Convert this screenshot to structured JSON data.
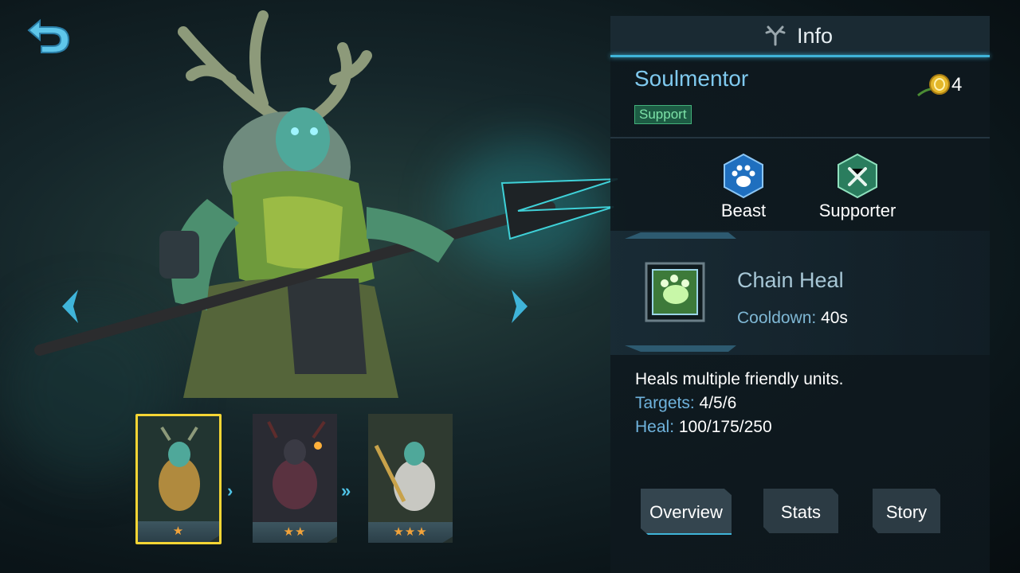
{
  "header": {
    "title": "Info"
  },
  "hero": {
    "name": "Soulmentor",
    "role": "Support",
    "cost": "4"
  },
  "traits": [
    {
      "label": "Beast",
      "icon": "paw-icon",
      "color": "#1f6fbf"
    },
    {
      "label": "Supporter",
      "icon": "hammer-icon",
      "color": "#2a7d5e"
    }
  ],
  "ability": {
    "name": "Chain Heal",
    "cooldown_label": "Cooldown:",
    "cooldown_value": "40s",
    "description": "Heals multiple friendly units.",
    "stats": [
      {
        "label": "Targets:",
        "value": "4/5/6"
      },
      {
        "label": "Heal:",
        "value": "100/175/250"
      }
    ]
  },
  "skins": [
    {
      "stars": "★",
      "selected": true
    },
    {
      "stars": "★★",
      "selected": false
    },
    {
      "stars": "★★★",
      "selected": false
    }
  ],
  "tabs": [
    {
      "label": "Overview",
      "active": true
    },
    {
      "label": "Stats",
      "active": false
    },
    {
      "label": "Story",
      "active": false
    }
  ],
  "colors": {
    "accent": "#3fb4d9",
    "name": "#7fc9ee",
    "role_badge": "#1d5c44",
    "gold": "#f5d534"
  }
}
